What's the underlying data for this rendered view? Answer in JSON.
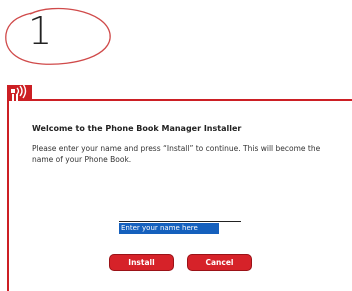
{
  "step": {
    "number": "1"
  },
  "app": {
    "logo_icon": "phone-signal-logo-icon",
    "accent_color": "#cc1f24"
  },
  "dialog": {
    "title": "Welcome to the Phone Book Manager Installer",
    "body": "Please enter your name and press “Install” to continue. This will become the name of your Phone Book.",
    "name_field": {
      "value": "Enter your name here"
    },
    "install_label": "Install",
    "cancel_label": "Cancel"
  }
}
